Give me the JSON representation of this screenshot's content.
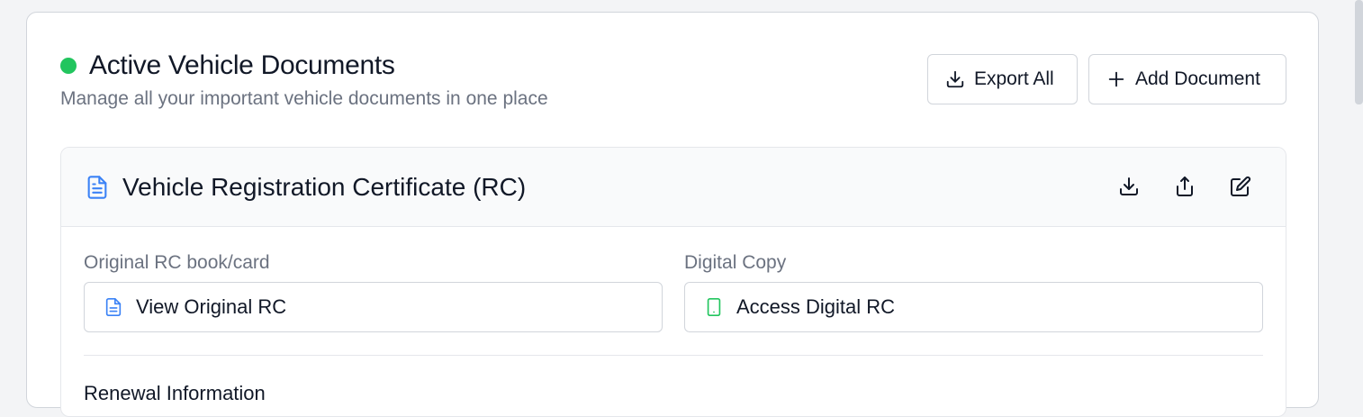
{
  "header": {
    "title": "Active Vehicle Documents",
    "subtitle": "Manage all your important vehicle documents in one place",
    "status_color": "#22c55e",
    "export_label": "Export All",
    "add_label": "Add Document"
  },
  "document": {
    "title": "Vehicle Registration Certificate (RC)",
    "icon": "file-text-icon",
    "actions": [
      "download-icon",
      "upload-icon",
      "edit-icon"
    ],
    "original": {
      "label": "Original RC book/card",
      "button": "View Original RC",
      "icon": "file-text-icon"
    },
    "digital": {
      "label": "Digital Copy",
      "button": "Access Digital RC",
      "icon": "smartphone-icon"
    },
    "renewal_title": "Renewal Information"
  },
  "colors": {
    "accent_blue": "#3b82f6",
    "accent_green": "#22c55e"
  }
}
